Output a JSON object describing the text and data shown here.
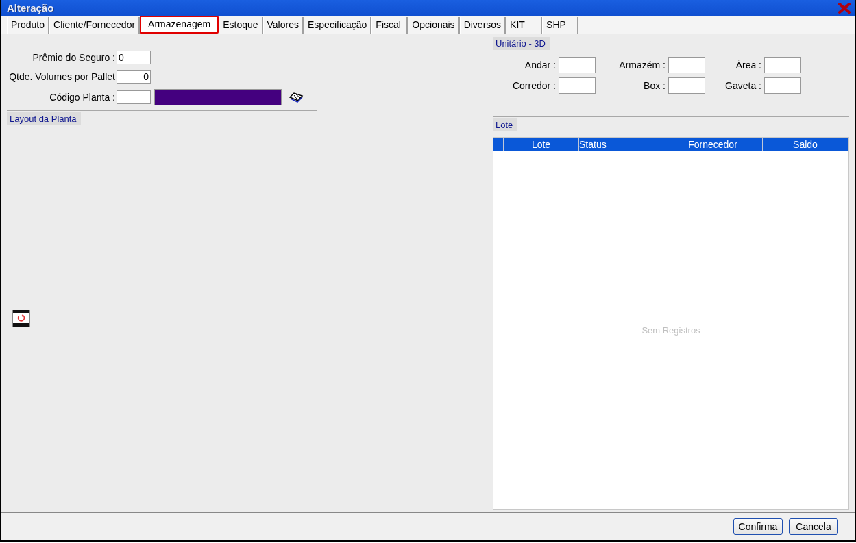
{
  "window": {
    "title": "Alteração"
  },
  "tabs": [
    {
      "label": "Produto",
      "selected": false
    },
    {
      "label": "Cliente/Fornecedor",
      "selected": false
    },
    {
      "label": "Armazenagem",
      "selected": true
    },
    {
      "label": "Estoque",
      "selected": false
    },
    {
      "label": "Valores",
      "selected": false
    },
    {
      "label": "Especificação",
      "selected": false
    },
    {
      "label": "Fiscal",
      "selected": false
    },
    {
      "label": "Opcionais",
      "selected": false
    },
    {
      "label": "Diversos",
      "selected": false
    },
    {
      "label": "KIT",
      "selected": false
    },
    {
      "label": "SHP",
      "selected": false
    }
  ],
  "fields": [
    {
      "label": "Prêmio do Seguro :",
      "value": "0",
      "kind": "text"
    },
    {
      "label": "Qtde. Volumes por Pallet",
      "value": "0",
      "kind": "number"
    },
    {
      "label": "Código Planta :",
      "kind": "text"
    }
  ],
  "layout_section": {
    "title": "Layout da Planta"
  },
  "unit_3d": {
    "title": "Unitário - 3D",
    "fields": [
      {
        "label": "Andar :"
      },
      {
        "label": "Armazém :"
      },
      {
        "label": "Área :"
      },
      {
        "label": "Corredor :"
      },
      {
        "label": "Box :"
      },
      {
        "label": "Gaveta :"
      }
    ]
  },
  "lote": {
    "title": "Lote",
    "columns": [
      "Lote",
      "Status",
      "Fornecedor",
      "Saldo"
    ],
    "empty_message": "Sem Registros"
  },
  "buttons": [
    "Confirma",
    "Cancela"
  ]
}
